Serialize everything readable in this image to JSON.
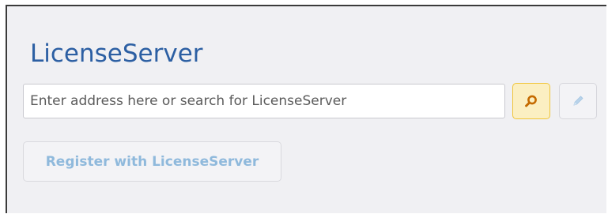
{
  "title": "LicenseServer",
  "search": {
    "placeholder": "Enter address here or search for LicenseServer",
    "value": ""
  },
  "buttons": {
    "search_icon": "search-icon",
    "edit_icon": "pencil-icon",
    "register_label": "Register with LicenseServer",
    "register_enabled": false,
    "edit_enabled": false
  },
  "colors": {
    "title": "#2c5fa3",
    "search_button_bg": "#fbefc2",
    "search_button_border": "#f0c53a",
    "disabled_text": "#8fb9dc"
  }
}
